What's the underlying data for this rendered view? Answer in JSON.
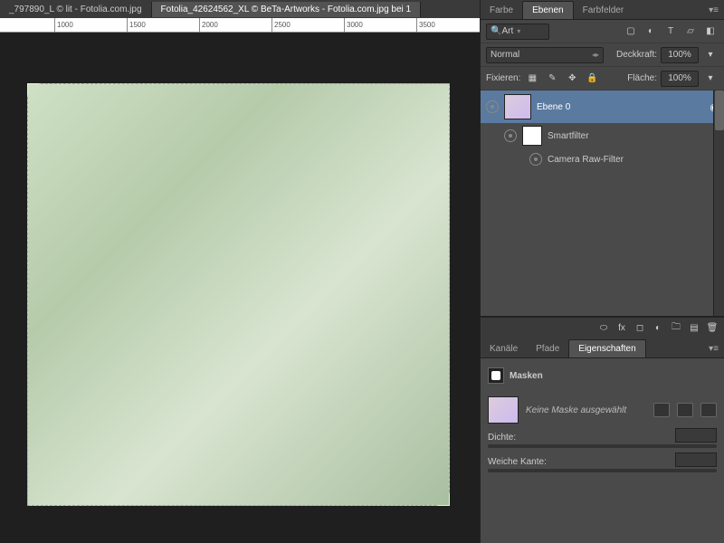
{
  "doc_tabs": {
    "left": "_797890_L © lit - Fotolia.com.jpg",
    "active": "Fotolia_42624562_XL © BeTa-Artworks - Fotolia.com.jpg bei 1"
  },
  "ruler_ticks": [
    "1000",
    "1500",
    "2000",
    "2500",
    "3000",
    "3500"
  ],
  "panels": {
    "top_tabs": {
      "farbe": "Farbe",
      "ebenen": "Ebenen",
      "farbfelder": "Farbfelder"
    },
    "filter_row": {
      "search_label": "Art"
    },
    "blend_row": {
      "mode": "Normal",
      "opacity_label": "Deckkraft:",
      "opacity_value": "100%"
    },
    "lock_row": {
      "fix_label": "Fixieren:",
      "fill_label": "Fläche:",
      "fill_value": "100%"
    },
    "layers": {
      "ebene0": "Ebene 0",
      "smartfilter": "Smartfilter",
      "camera_raw": "Camera Raw-Filter"
    },
    "bottom_tabs": {
      "kanale": "Kanäle",
      "pfade": "Pfade",
      "eigenschaften": "Eigenschaften"
    },
    "props": {
      "title": "Masken",
      "no_mask": "Keine Maske ausgewählt",
      "density": "Dichte:",
      "feather": "Weiche Kante:"
    }
  }
}
